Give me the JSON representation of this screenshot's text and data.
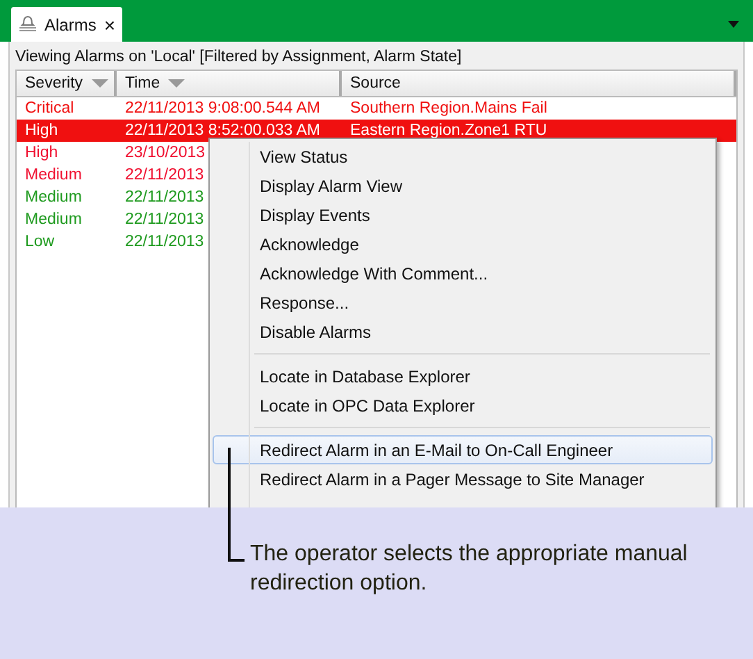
{
  "tab": {
    "label": "Alarms",
    "close": "×"
  },
  "panel": {
    "caption": "Viewing Alarms on 'Local' [Filtered by Assignment, Alarm State]"
  },
  "table": {
    "columns": [
      {
        "label": "Severity",
        "sorted": true
      },
      {
        "label": "Time",
        "sorted": true
      },
      {
        "label": "Source",
        "sorted": false
      }
    ],
    "rows": [
      {
        "severity": "Critical",
        "time": "22/11/2013 9:08:00.544 AM",
        "source": "Southern Region.Mains Fail",
        "color": "#f01010",
        "selected": false
      },
      {
        "severity": "High",
        "time": "22/11/2013 8:52:00.033 AM",
        "source": "Eastern Region.Zone1 RTU",
        "color": "#f01010",
        "selected": true
      },
      {
        "severity": "High",
        "time": "23/10/2013",
        "color": "#f01030",
        "selected": false
      },
      {
        "severity": "Medium",
        "time": "22/11/2013",
        "color": "#f01030",
        "selected": false
      },
      {
        "severity": "Medium",
        "time": "22/11/2013",
        "color": "#1e9a1e",
        "selected": false
      },
      {
        "severity": "Medium",
        "time": "22/11/2013",
        "color": "#1e9a1e",
        "selected": false
      },
      {
        "severity": "Low",
        "time": "22/11/2013",
        "color": "#1e9a1e",
        "selected": false
      }
    ]
  },
  "context_menu": {
    "groups": [
      {
        "items": [
          {
            "label": "View Status",
            "selected": false
          },
          {
            "label": "Display Alarm View",
            "selected": false
          },
          {
            "label": "Display Events",
            "selected": false
          },
          {
            "label": "Acknowledge",
            "selected": false
          },
          {
            "label": "Acknowledge With Comment...",
            "selected": false
          },
          {
            "label": "Response...",
            "selected": false
          },
          {
            "label": "Disable Alarms",
            "selected": false
          }
        ]
      },
      {
        "items": [
          {
            "label": "Locate in Database Explorer",
            "selected": false
          },
          {
            "label": "Locate in OPC Data Explorer",
            "selected": false
          }
        ]
      },
      {
        "items": [
          {
            "label": "Redirect Alarm in an E-Mail to On-Call Engineer",
            "selected": true
          },
          {
            "label": "Redirect Alarm in a Pager Message to Site Manager",
            "selected": false
          }
        ]
      }
    ]
  },
  "callout": {
    "text": "The operator selects the appropriate manual redirection option."
  }
}
